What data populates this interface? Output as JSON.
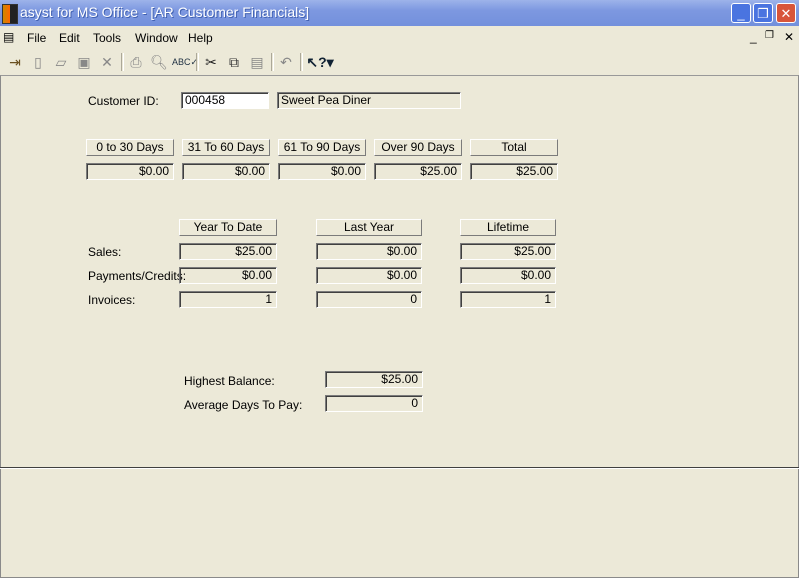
{
  "window": {
    "title": "asyst for MS Office - [AR Customer Financials]"
  },
  "menu": [
    "File",
    "Edit",
    "Tools",
    "Window",
    "Help"
  ],
  "toolbar": [
    "exit-icon",
    "new-icon",
    "open-icon",
    "save-icon",
    "delete-icon",
    "print-icon",
    "print-preview-icon",
    "spell-check-icon",
    "cut-icon",
    "copy-icon",
    "paste-icon",
    "undo-icon",
    "whats-this-help-icon"
  ],
  "customer": {
    "label": "Customer ID:",
    "id": "000458",
    "name": "Sweet Pea Diner"
  },
  "aging": {
    "headers": [
      "0 to 30 Days",
      "31 To 60 Days",
      "61 To 90 Days",
      "Over 90 Days",
      "Total"
    ],
    "values": [
      "$0.00",
      "$0.00",
      "$0.00",
      "$25.00",
      "$25.00"
    ]
  },
  "summary": {
    "columns": [
      "Year To Date",
      "Last Year",
      "Lifetime"
    ],
    "rows": [
      {
        "label": "Sales:",
        "values": [
          "$25.00",
          "$0.00",
          "$25.00"
        ]
      },
      {
        "label": "Payments/Credits:",
        "values": [
          "$0.00",
          "$0.00",
          "$0.00"
        ]
      },
      {
        "label": "Invoices:",
        "values": [
          "1",
          "0",
          "1"
        ]
      }
    ]
  },
  "stats": {
    "highest_label": "Highest Balance:",
    "highest": "$25.00",
    "avg_label": "Average Days To Pay:",
    "avg": "0"
  }
}
